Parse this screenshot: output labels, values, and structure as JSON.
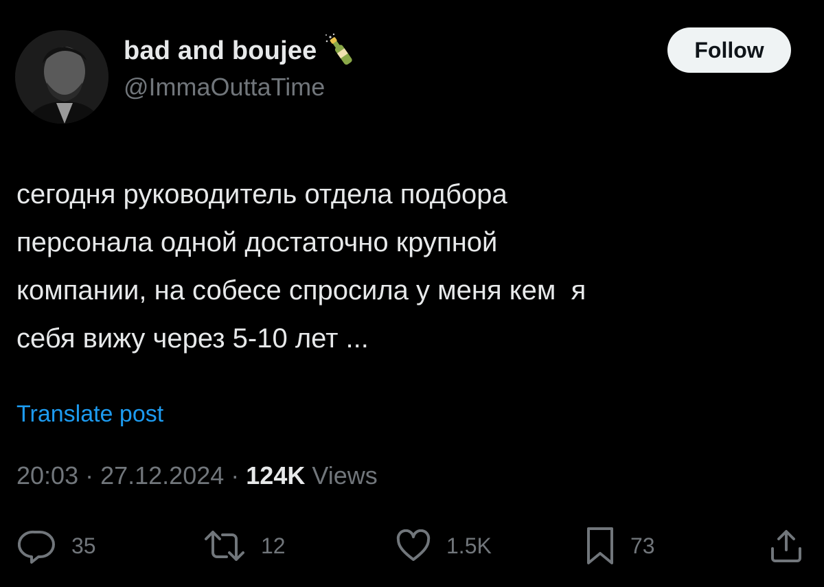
{
  "author": {
    "display_name": "bad and boujee",
    "name_emoji": "champagne-bottle",
    "handle": "@ImmaOuttaTime"
  },
  "follow_button": {
    "label": "Follow"
  },
  "post": {
    "lines": [
      "сегодня руководитель отдела подбора",
      "персонала одной достаточно крупной",
      "компании, на собесе спросила у меня кем  я",
      "себя вижу через 5-10 лет ..."
    ],
    "translate_label": "Translate post"
  },
  "meta": {
    "time": "20:03",
    "separator": " · ",
    "date": "27.12.2024",
    "views_count": "124K",
    "views_label": " Views"
  },
  "actions": {
    "replies": "35",
    "reposts": "12",
    "likes": "1.5K",
    "bookmarks": "73"
  },
  "colors": {
    "background": "#000000",
    "text_primary": "#e7e9ea",
    "text_secondary": "#71767b",
    "link": "#1d9bf0",
    "button_bg": "#eff3f4"
  }
}
